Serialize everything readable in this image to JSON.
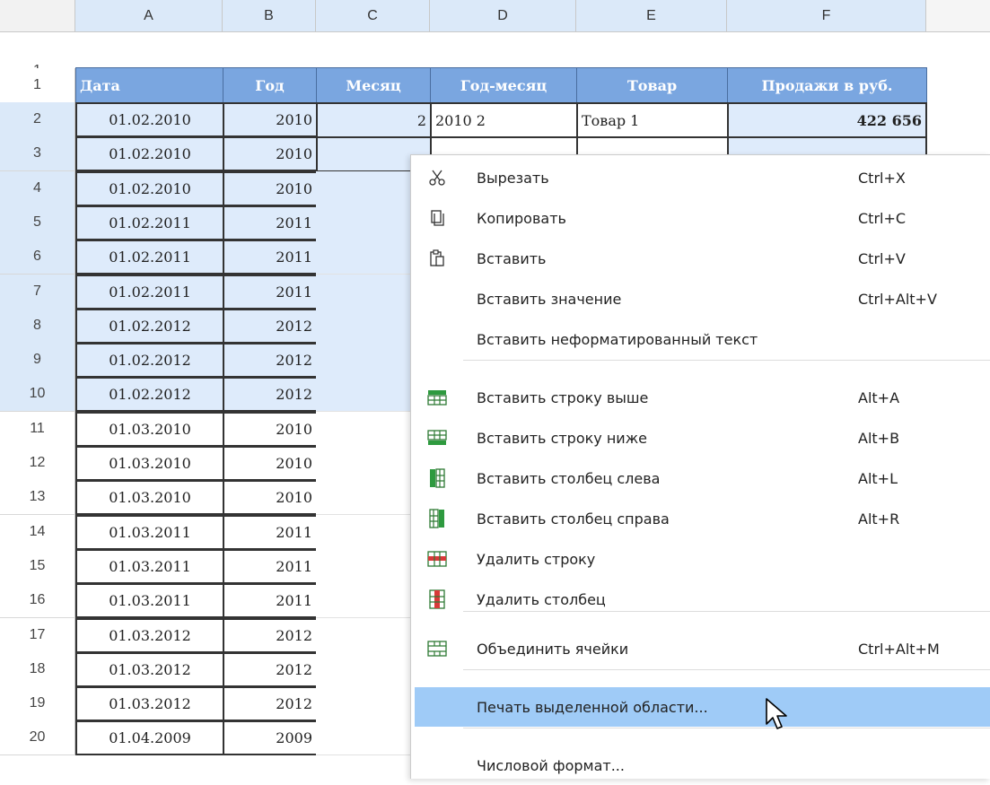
{
  "columns": [
    "A",
    "B",
    "C",
    "D",
    "E",
    "F"
  ],
  "header_row": {
    "number": "1",
    "cells": [
      "Дата",
      "Год",
      "Месяц",
      "Год-месяц",
      "Товар",
      "Продажи в руб."
    ]
  },
  "rows": [
    {
      "number": "2",
      "date": "01.02.2010",
      "year": "2010",
      "month": "2",
      "year_month": "2010 2",
      "product": "Товар 1",
      "sales": "422 656"
    },
    {
      "number": "3",
      "date": "01.02.2010",
      "year": "2010"
    },
    {
      "number": "4",
      "date": "01.02.2010",
      "year": "2010"
    },
    {
      "number": "5",
      "date": "01.02.2011",
      "year": "2011"
    },
    {
      "number": "6",
      "date": "01.02.2011",
      "year": "2011"
    },
    {
      "number": "7",
      "date": "01.02.2011",
      "year": "2011"
    },
    {
      "number": "8",
      "date": "01.02.2012",
      "year": "2012"
    },
    {
      "number": "9",
      "date": "01.02.2012",
      "year": "2012"
    },
    {
      "number": "10",
      "date": "01.02.2012",
      "year": "2012"
    },
    {
      "number": "11",
      "date": "01.03.2010",
      "year": "2010"
    },
    {
      "number": "12",
      "date": "01.03.2010",
      "year": "2010"
    },
    {
      "number": "13",
      "date": "01.03.2010",
      "year": "2010"
    },
    {
      "number": "14",
      "date": "01.03.2011",
      "year": "2011"
    },
    {
      "number": "15",
      "date": "01.03.2011",
      "year": "2011"
    },
    {
      "number": "16",
      "date": "01.03.2011",
      "year": "2011"
    },
    {
      "number": "17",
      "date": "01.03.2012",
      "year": "2012"
    },
    {
      "number": "18",
      "date": "01.03.2012",
      "year": "2012"
    },
    {
      "number": "19",
      "date": "01.03.2012",
      "year": "2012"
    },
    {
      "number": "20",
      "date": "01.04.2009",
      "year": "2009"
    }
  ],
  "context_menu": {
    "items": [
      {
        "id": "cut",
        "label": "Вырезать",
        "shortcut": "Ctrl+X",
        "icon": "scissors-icon"
      },
      {
        "id": "copy",
        "label": "Копировать",
        "shortcut": "Ctrl+C",
        "icon": "copy-icon"
      },
      {
        "id": "paste",
        "label": "Вставить",
        "shortcut": "Ctrl+V",
        "icon": "paste-icon"
      },
      {
        "id": "paste-value",
        "label": "Вставить значение",
        "shortcut": "Ctrl+Alt+V",
        "icon": ""
      },
      {
        "id": "paste-unformatted",
        "label": "Вставить неформатированный текст",
        "shortcut": "",
        "icon": ""
      },
      {
        "id": "insert-row-above",
        "label": "Вставить строку выше",
        "shortcut": "Alt+A",
        "icon": "insert-row-above-icon"
      },
      {
        "id": "insert-row-below",
        "label": "Вставить строку ниже",
        "shortcut": "Alt+B",
        "icon": "insert-row-below-icon"
      },
      {
        "id": "insert-col-left",
        "label": "Вставить столбец слева",
        "shortcut": "Alt+L",
        "icon": "insert-column-left-icon"
      },
      {
        "id": "insert-col-right",
        "label": "Вставить столбец справа",
        "shortcut": "Alt+R",
        "icon": "insert-column-right-icon"
      },
      {
        "id": "delete-row",
        "label": "Удалить строку",
        "shortcut": "",
        "icon": "delete-row-icon"
      },
      {
        "id": "delete-col",
        "label": "Удалить столбец",
        "shortcut": "",
        "icon": "delete-column-icon"
      },
      {
        "id": "merge-cells",
        "label": "Объединить ячейки",
        "shortcut": "Ctrl+Alt+M",
        "icon": "merge-cells-icon"
      },
      {
        "id": "print-selection",
        "label": "Печать выделенной области...",
        "shortcut": "",
        "icon": "",
        "highlighted": true
      },
      {
        "id": "number-format",
        "label": "Числовой формат...",
        "shortcut": "",
        "icon": ""
      }
    ]
  },
  "colors": {
    "selection_fill": "#deebfb",
    "header_fill": "#7aa6e0",
    "menu_highlight": "#9fcbf7",
    "selected_col_header": "#dbe9f9"
  }
}
